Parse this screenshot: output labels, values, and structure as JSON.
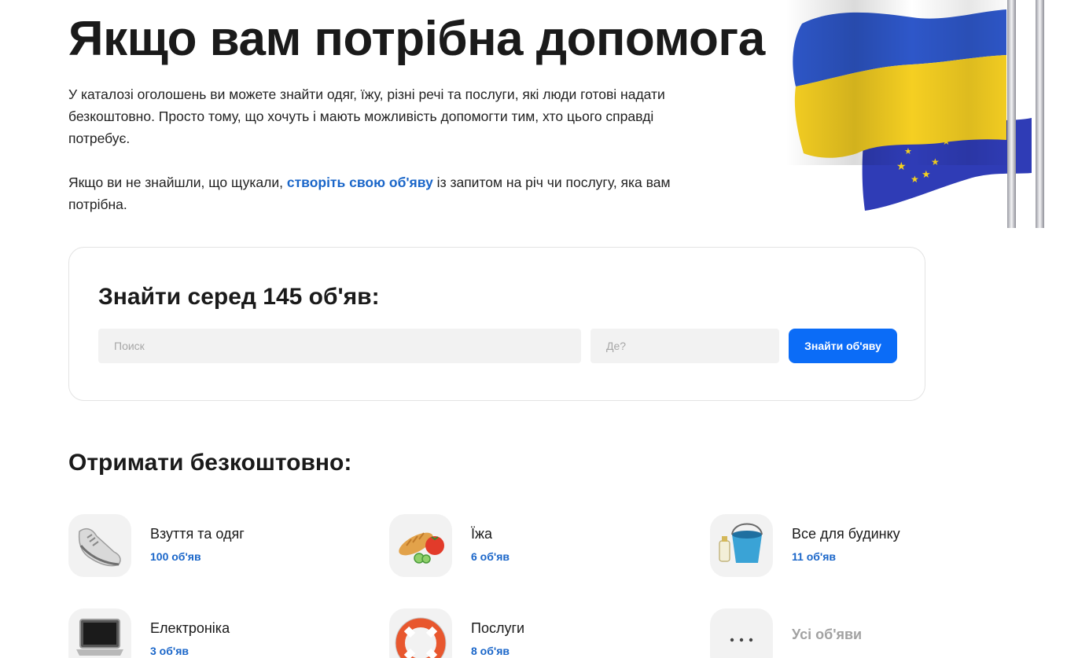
{
  "hero": {
    "title": "Якщо вам потрібна допомога",
    "paragraph1": "У каталозі оголошень ви можете знайти одяг, їжу, різні речі та послуги, які люди готові надати безкоштовно. Просто тому, що хочуть і мають можливість допомогти тим, хто цього справді потребує.",
    "p2_before": "Якщо ви не знайшли, що щукали, ",
    "p2_link": "створіть свою об'яву",
    "p2_after": " із запитом на річ чи послугу, яка вам потрібна."
  },
  "search": {
    "title_prefix": "Знайти серед ",
    "count": "145",
    "title_suffix": " об'яв:",
    "query_placeholder": "Поиск",
    "where_placeholder": "Де?",
    "button_label": "Знайти об'яву"
  },
  "categories_section": {
    "title": "Отримати безкоштовно:",
    "items": [
      {
        "name": "Взуття та одяг",
        "count": "100 об'яв",
        "icon": "sneaker-icon"
      },
      {
        "name": "Їжа",
        "count": "6 об'яв",
        "icon": "food-icon"
      },
      {
        "name": "Все для будинку",
        "count": "11 об'яв",
        "icon": "bucket-icon"
      },
      {
        "name": "Електроніка",
        "count": "3 об'яв",
        "icon": "laptop-icon"
      },
      {
        "name": "Послуги",
        "count": "8 об'яв",
        "icon": "lifebuoy-icon"
      },
      {
        "name": "Усі об'яви",
        "icon": "more-dots-icon"
      }
    ]
  },
  "colors": {
    "accent": "#0b6cf7",
    "link": "#1a66c9",
    "flag_blue": "#2f55c7",
    "flag_yellow": "#f6d21f",
    "tile_bg": "#f2f2f2"
  }
}
